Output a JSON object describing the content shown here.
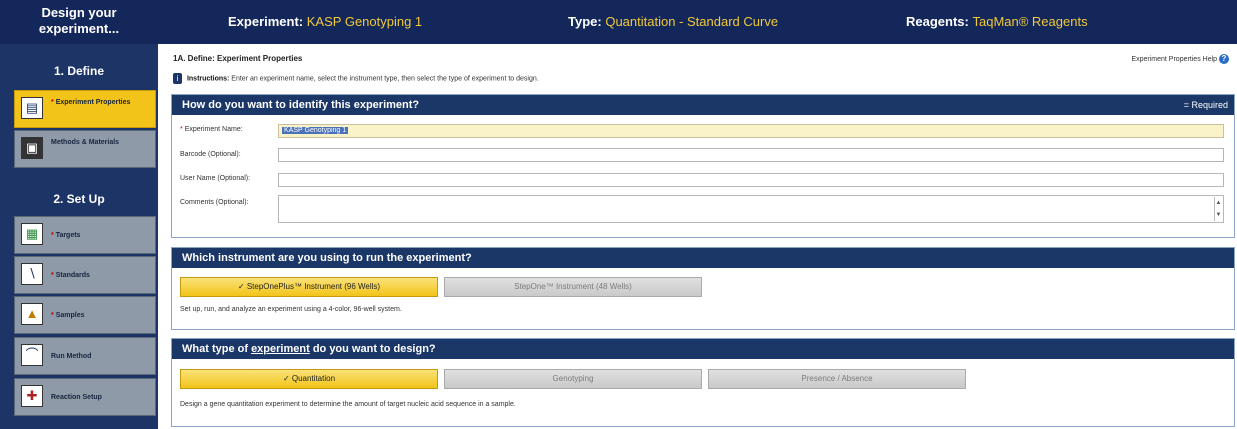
{
  "header": {
    "design_title": "Design your experiment...",
    "experiment_label": "Experiment:",
    "experiment_value": "KASP Genotyping 1",
    "type_label": "Type:",
    "type_value": "Quantitation - Standard Curve",
    "reagents_label": "Reagents:",
    "reagents_value": "TaqMan® Reagents"
  },
  "sidebar": {
    "section_define": "1. Define",
    "section_setup": "2. Set Up",
    "items": [
      {
        "label": "Experiment Properties",
        "required": "*",
        "icon": "document-icon"
      },
      {
        "label": "Methods & Materials",
        "required": "",
        "icon": "book-icon"
      },
      {
        "label": "Targets",
        "required": "*",
        "icon": "targets-icon"
      },
      {
        "label": "Standards",
        "required": "*",
        "icon": "standards-icon"
      },
      {
        "label": "Samples",
        "required": "*",
        "icon": "samples-icon"
      },
      {
        "label": "Run Method",
        "required": "",
        "icon": "run-method-icon"
      },
      {
        "label": "Reaction Setup",
        "required": "",
        "icon": "reaction-setup-icon"
      }
    ]
  },
  "main": {
    "page_title": "1A. Define: Experiment Properties",
    "help_label": "Experiment Properties Help",
    "instructions_label": "Instructions:",
    "instructions_text": "Enter an experiment name, select the instrument type, then select the type of experiment to design.",
    "identify": {
      "title": "How do you want to identify this experiment?",
      "required_note": "= Required",
      "required_mark": "*",
      "fields": [
        {
          "label": "Experiment Name:",
          "value": "KASP Genotyping 1"
        },
        {
          "label": "Barcode (Optional):",
          "value": ""
        },
        {
          "label": "User Name (Optional):",
          "value": ""
        },
        {
          "label": "Comments (Optional):",
          "value": ""
        }
      ]
    },
    "instrument": {
      "title": "Which instrument are you using to run the experiment?",
      "options": [
        "✓ StepOnePlus™ Instrument (96 Wells)",
        "StepOne™ Instrument (48 Wells)"
      ],
      "description": "Set up, run, and analyze an experiment using a 4-color, 96-well system."
    },
    "experiment_type": {
      "title_prefix": "What type of ",
      "title_link": "experiment",
      "title_suffix": " do you want to design?",
      "options": [
        "✓ Quantitation",
        "Genotyping",
        "Presence / Absence"
      ],
      "description": "Design a gene quantitation experiment to determine the amount of target nucleic acid sequence in a sample."
    }
  }
}
